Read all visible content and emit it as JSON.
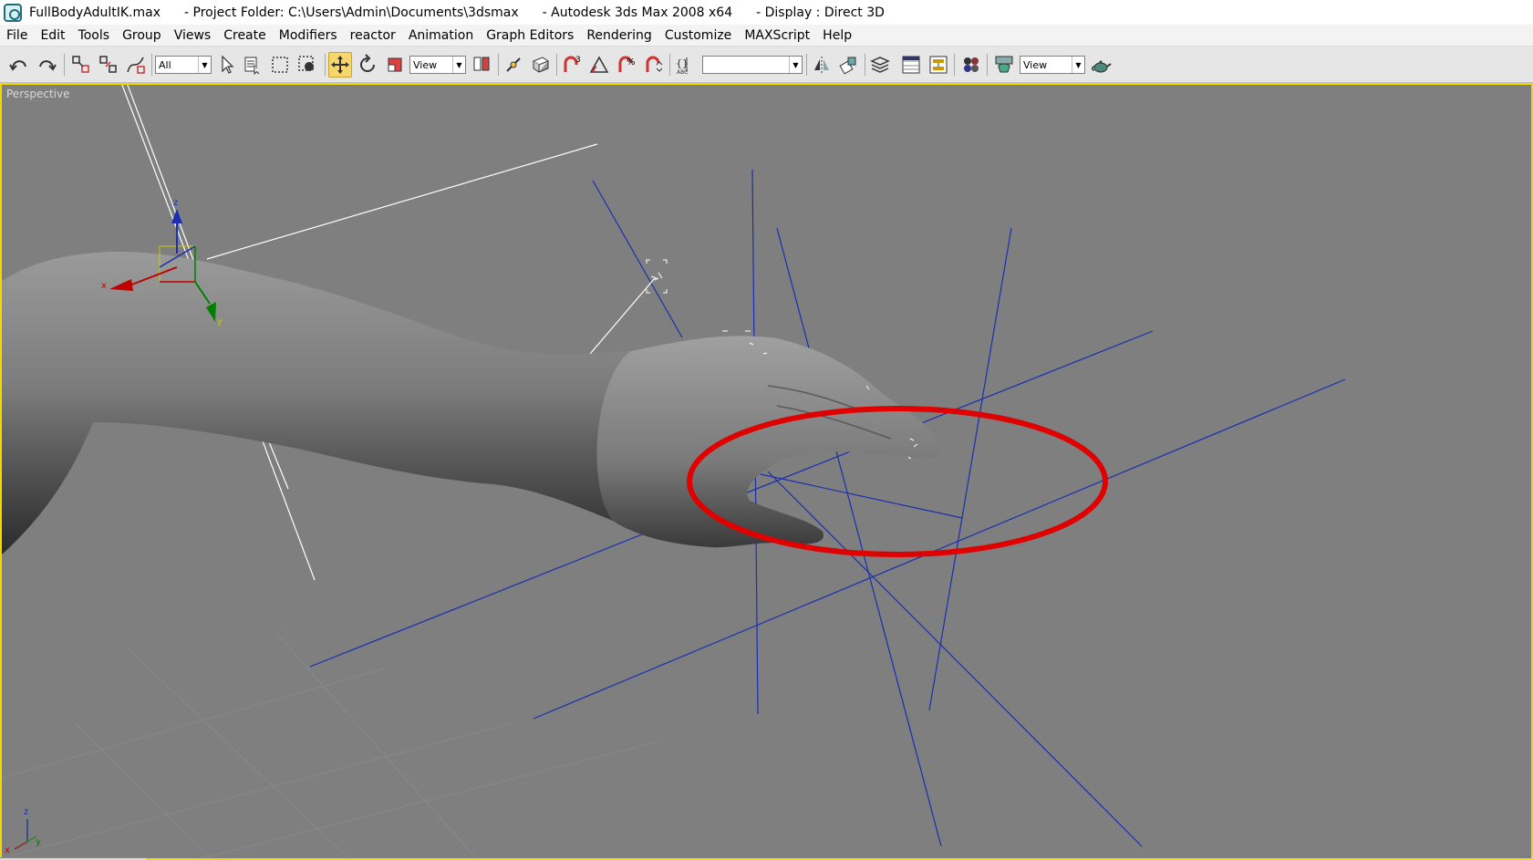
{
  "window": {
    "file_name": "FullBodyAdultIK.max",
    "project_folder": "- Project Folder: C:\\Users\\Admin\\Documents\\3dsmax",
    "app_name": "- Autodesk 3ds Max 2008 x64",
    "display": "- Display : Direct 3D"
  },
  "menu": [
    "File",
    "Edit",
    "Tools",
    "Group",
    "Views",
    "Create",
    "Modifiers",
    "reactor",
    "Animation",
    "Graph Editors",
    "Rendering",
    "Customize",
    "MAXScript",
    "Help"
  ],
  "toolbar": {
    "selection_filter": "All",
    "reference_coord": "View",
    "named_selection": "",
    "render_view": "View",
    "active_tool": "move-icon"
  },
  "viewport": {
    "label": "Perspective",
    "gizmo_axes": {
      "x": "x",
      "y": "y",
      "z": "z"
    },
    "corner_axes": {
      "z": "z",
      "y": "y",
      "x": "x"
    },
    "highlight_color": "#e00000",
    "helper_color": "#1a2fb0",
    "bone_color": "#ffffff"
  },
  "colors": {
    "viewport_bg": "#7f7f7f",
    "active_border": "#f0d800",
    "toolbar_bg": "#e6e6e6"
  }
}
